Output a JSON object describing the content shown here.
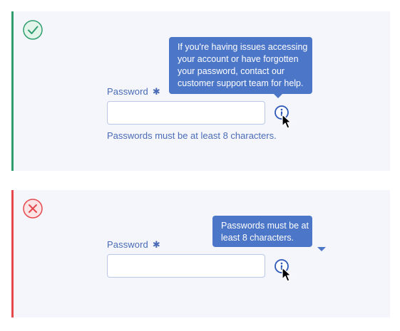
{
  "success_example": {
    "status_icon": "check-circle-icon",
    "label": "Password",
    "required_marker": "✱",
    "input_value": "",
    "info_icon": "info-icon",
    "tooltip_lines": [
      "If you're having issues accessing",
      "your account or have forgotten",
      "your password, contact our",
      "customer support team for help."
    ],
    "help_text": "Passwords must be at least 8 characters."
  },
  "error_example": {
    "status_icon": "x-circle-icon",
    "label": "Password",
    "required_marker": "✱",
    "input_value": "",
    "info_icon": "info-icon",
    "tooltip_lines": [
      "Passwords must be at",
      "least 8 characters."
    ]
  },
  "colors": {
    "success": "#2e9e6e",
    "error": "#e5484d",
    "accent": "#4a6bb7",
    "tooltip_bg": "#4c76c8",
    "panel_bg": "#f4f6fb"
  }
}
